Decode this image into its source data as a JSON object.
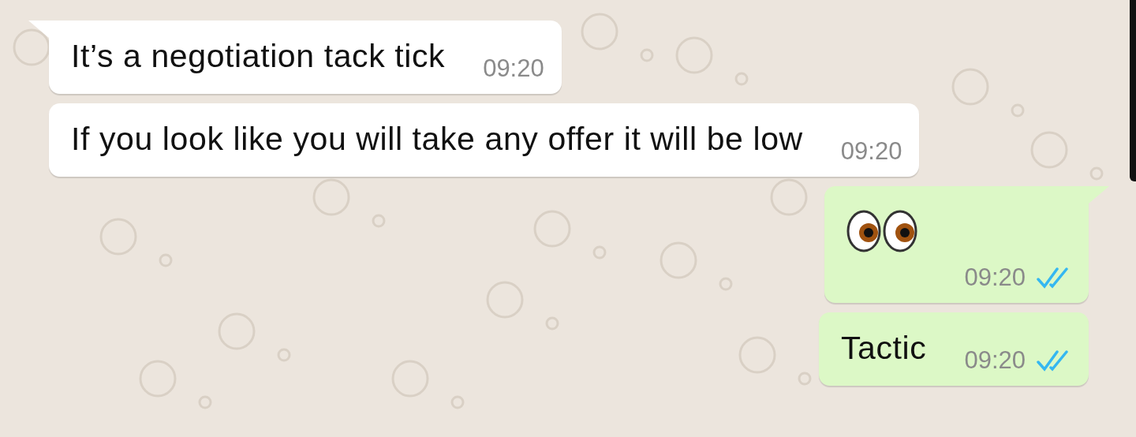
{
  "messages": [
    {
      "outgoing": false,
      "kind": "text",
      "text": "It’s a negotiation tack tick",
      "time": "09:20",
      "tail": true
    },
    {
      "outgoing": false,
      "kind": "text",
      "text": "If you look like you will take any offer it will be low",
      "time": "09:20",
      "tail": false
    },
    {
      "outgoing": true,
      "kind": "emoji_eyes",
      "time": "09:20",
      "read": true,
      "tail": true
    },
    {
      "outgoing": true,
      "kind": "text",
      "text": "Tactic",
      "time": "09:20",
      "read": true,
      "tail": false
    }
  ]
}
